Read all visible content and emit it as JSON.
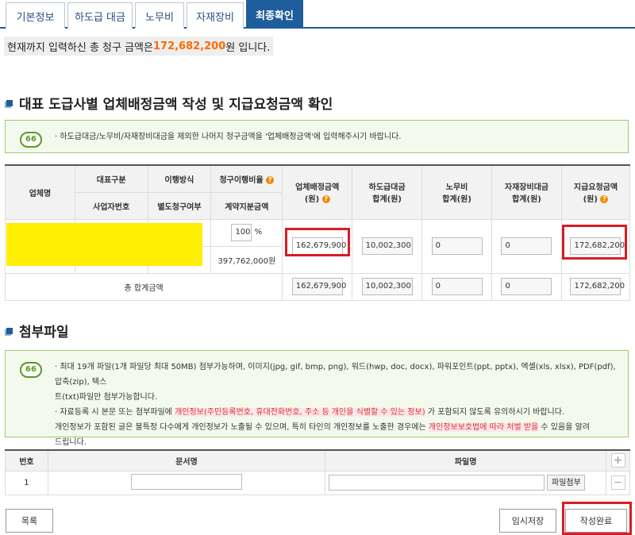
{
  "tabs": [
    "기본정보",
    "하도급 대금",
    "노무비",
    "자재장비",
    "최종확인"
  ],
  "total_bar": {
    "prefix": "현재까지 입력하신 총 청구 금액은 ",
    "amount": "172,682,200",
    "suffix": "원 입니다."
  },
  "section1": {
    "title": "대표 도급사별 업체배정금액 작성 및 지급요청금액 확인",
    "notice": "·  하도급대금/노무비/자재장비대금을 제외한 나머지 청구금액을 '업체배정금액'에 입력해주시기 바랍니다."
  },
  "table": {
    "headers": {
      "company": "업체명",
      "rep_type": "대표구분",
      "biz_no": "사업자번호",
      "method": "이행방식",
      "split_claim": "별도청구여부",
      "ratio": "청구이행비율",
      "contract_share": "계약지분금액",
      "assigned": "업체배정금액",
      "assigned_unit": "(원)",
      "subcontract": "하도급대금",
      "subcontract_unit": "합계(원)",
      "labor": "노무비",
      "labor_unit": "합계(원)",
      "equipment": "자재장비대금",
      "equipment_unit": "합계(원)",
      "request": "지급요청금액",
      "request_unit": "(원)"
    },
    "row": {
      "ratio": "100",
      "ratio_unit": "%",
      "contract_share": "397,762,000원",
      "assigned": "162,679,900",
      "subcontract": "10,002,300",
      "labor": "0",
      "equipment": "0",
      "request": "172,682,200"
    },
    "total": {
      "label": "총 합계금액",
      "assigned": "162,679,900",
      "subcontract": "10,002,300",
      "labor": "0",
      "equipment": "0",
      "request": "172,682,200"
    }
  },
  "section2": {
    "title": "첨부파일",
    "notice_line1": "·  최대 19개 파일(1개 파일당 최대 50MB) 첨부가능하며, 이미지(jpg, gif, bmp, png), 워드(hwp, doc, docx), 파워포인트(ppt, pptx), 엑셀(xls, xlsx), PDF(pdf), 압축(zip), 텍스",
    "notice_line2": "트(txt)파일만 첨부가능합니다.",
    "notice_line3_a": "·  자료등록 시 본문 또는 첨부파일에 ",
    "notice_line3_red": "개인정보(주민등록번호, 휴대전화번호, 주소 등 개인을 식별할 수 있는 정보)",
    "notice_line3_b": " 가 포함되지 않도록 유의하시기 바랍니다.",
    "notice_line4_a": "개인정보가 포함된 글은 불특정 다수에게 개인정보가 노출될 수 있으며, 특히 타인의 개인정보를 노출한 경우에는 ",
    "notice_line4_red": "개인정보보호법에 따라 처벌 받을",
    "notice_line4_b": " 수 있음을 알려",
    "notice_line5": "드립니다."
  },
  "attach_table": {
    "col_no": "번호",
    "col_doc": "문서명",
    "col_file": "파일명",
    "row_no": "1",
    "attach_button": "파일첨부",
    "add": "+",
    "remove": "−"
  },
  "buttons": {
    "list": "목록",
    "temp_save": "임시저장",
    "complete": "작성완료"
  },
  "colors": {
    "brand": "#1e5d9b",
    "accent": "#ff6a00",
    "highlight": "#d91c24"
  }
}
